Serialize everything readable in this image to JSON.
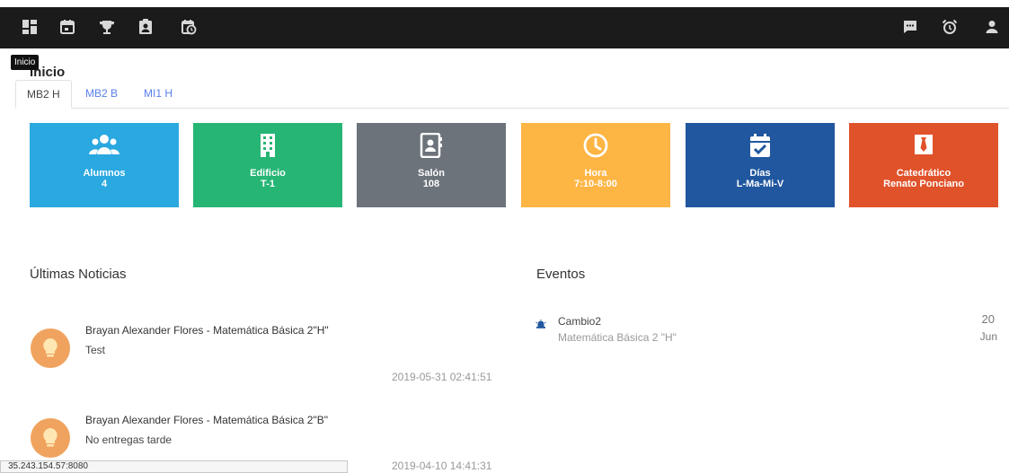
{
  "topbar": {
    "left_icons": [
      "dashboard-icon",
      "calendar-icon",
      "trophy-icon",
      "contact-card-icon",
      "schedule-icon"
    ],
    "right_icons": [
      "chat-icon",
      "alarm-clock-icon",
      "user-icon"
    ],
    "tooltip": "Inicio"
  },
  "page": {
    "title": "Inicio"
  },
  "tabs": [
    {
      "label": "MB2 H",
      "active": true
    },
    {
      "label": "MB2 B",
      "active": false
    },
    {
      "label": "MI1 H",
      "active": false
    }
  ],
  "cards": [
    {
      "label": "Alumnos",
      "value": "4",
      "color": "#2aa8e0",
      "icon": "users-icon"
    },
    {
      "label": "Edificio",
      "value": "T-1",
      "color": "#26b574",
      "icon": "building-icon"
    },
    {
      "label": "Salón",
      "value": "108",
      "color": "#6c737a",
      "icon": "address-book-icon"
    },
    {
      "label": "Hora",
      "value": "7:10-8:00",
      "color": "#fdb544",
      "icon": "clock-icon"
    },
    {
      "label": "Días",
      "value": "L-Ma-Mi-V",
      "color": "#20579e",
      "icon": "calendar-check-icon"
    },
    {
      "label": "Catedrático",
      "value": "Renato Ponciano",
      "color": "#e0522a",
      "icon": "necktie-icon"
    }
  ],
  "news": {
    "title": "Últimas Noticias",
    "items": [
      {
        "author": "Brayan Alexander Flores - Matemática Básica 2\"H\"",
        "body": "Test",
        "date": "2019-05-31 02:41:51"
      },
      {
        "author": "Brayan Alexander Flores - Matemática Básica 2\"B\"",
        "body": "No entregas tarde",
        "date": "2019-04-10 14:41:31"
      }
    ]
  },
  "events": {
    "title": "Eventos",
    "items": [
      {
        "title": "Cambio2",
        "subtitle": "Matemática Básica 2 \"H\"",
        "day": "20",
        "month": "Jun",
        "icon": "alarm-bell-icon"
      }
    ]
  },
  "status_bar": {
    "url": "35.243.154.57:8080"
  },
  "colors": {
    "topbar": "#1b1b1b",
    "tab_link": "#5a7fe8",
    "avatar": "#f0a35e"
  }
}
